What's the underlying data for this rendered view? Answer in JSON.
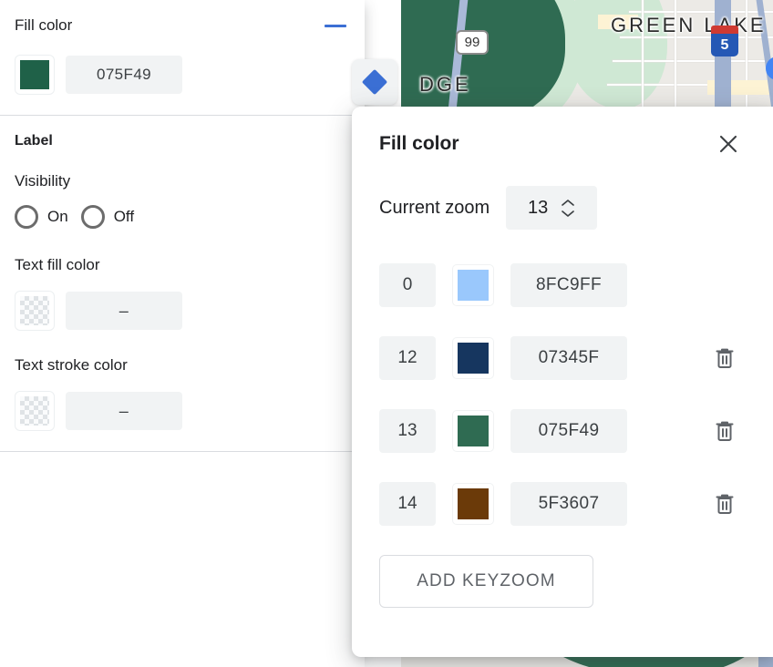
{
  "left_panel": {
    "fill_color_section": {
      "title": "Fill color",
      "collapse_icon": "minus-icon",
      "swatch_color": "#1F6148",
      "hex_value": "075F49"
    },
    "label_section": {
      "title": "Label",
      "visibility_label": "Visibility",
      "visibility_options": [
        {
          "label": "On",
          "selected": false
        },
        {
          "label": "Off",
          "selected": false
        }
      ],
      "text_fill_color": {
        "label": "Text fill color",
        "swatch": "transparent",
        "value": "–"
      },
      "text_stroke_color": {
        "label": "Text stroke color",
        "swatch": "transparent",
        "value": "–"
      }
    }
  },
  "floating_button": {
    "icon": "diamond-icon",
    "color": "#3B6FD4"
  },
  "dialog": {
    "title": "Fill color",
    "close_icon": "close-icon",
    "current_zoom": {
      "label": "Current zoom",
      "value": "13",
      "stepper_icon": "stepper-arrows-icon"
    },
    "keyzooms": [
      {
        "zoom": "0",
        "color": "#9AC8FC",
        "hex": "8FC9FF",
        "deletable": false
      },
      {
        "zoom": "12",
        "color": "#16365F",
        "hex": "07345F",
        "deletable": true
      },
      {
        "zoom": "13",
        "color": "#2F6B52",
        "hex": "075F49",
        "deletable": true
      },
      {
        "zoom": "14",
        "color": "#6B3A09",
        "hex": "5F3607",
        "deletable": true
      }
    ],
    "trash_icon": "trash-icon",
    "add_button_label": "ADD KEYZOOM"
  },
  "map": {
    "labels": {
      "green_lake": "GREEN LAKE",
      "dge": "DGE",
      "route_99": "99",
      "interstate_5": "5"
    }
  }
}
